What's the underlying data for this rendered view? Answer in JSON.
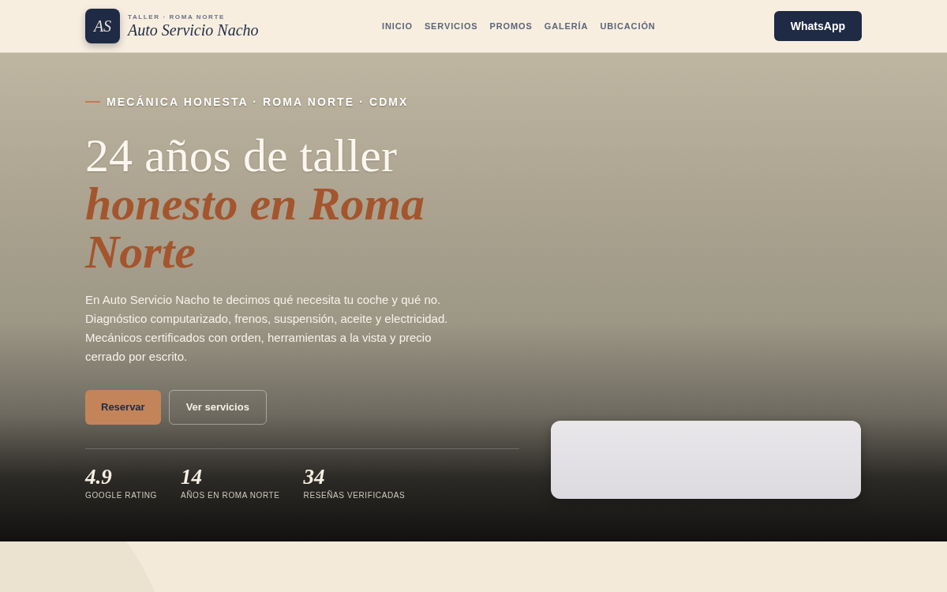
{
  "header": {
    "logo": {
      "monogram": "AS"
    },
    "tagline": "TALLER · ROMA NORTE",
    "brand": "Auto Servicio Nacho",
    "nav": [
      {
        "label": "INICIO"
      },
      {
        "label": "SERVICIOS"
      },
      {
        "label": "PROMOS"
      },
      {
        "label": "GALERÍA"
      },
      {
        "label": "UBICACIÓN"
      }
    ],
    "cta": {
      "label": "WhatsApp"
    }
  },
  "hero": {
    "eyebrow": "MECÁNICA HONESTA · ROMA NORTE · CDMX",
    "heading": "24 años de taller",
    "heading_accent": "honesto en Roma Norte",
    "description": "En Auto Servicio Nacho te decimos qué necesita tu coche y qué no. Diagnóstico computarizado, frenos, suspensión, aceite y electricidad. Mecánicos certificados con orden, herramientas a la vista y precio cerrado por escrito.",
    "buttons": [
      {
        "label": "Reservar",
        "kind": "primary"
      },
      {
        "label": "Ver servicios",
        "kind": "outline"
      }
    ],
    "stats": [
      {
        "value": "4.9",
        "label": "GOOGLE RATING"
      },
      {
        "value": "14",
        "label": "AÑOS EN ROMA NORTE"
      },
      {
        "value": "34",
        "label": "RESEÑAS VERIFICADAS"
      }
    ]
  }
}
